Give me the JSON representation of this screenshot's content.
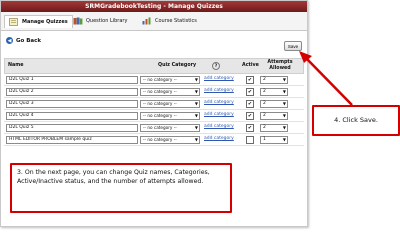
{
  "window": {
    "title": "SRMGradebookTesting - Manage Quizzes"
  },
  "tabs": [
    {
      "label": "Manage Quizzes",
      "icon": "manage-quizzes-icon"
    },
    {
      "label": "Question Library",
      "icon": "question-library-icon"
    },
    {
      "label": "Course Statistics",
      "icon": "course-statistics-icon"
    }
  ],
  "toolbar": {
    "go_back": "Go Back",
    "save": "Save"
  },
  "table": {
    "headers": {
      "name": "Name",
      "category": "Quiz Category",
      "active": "Active",
      "attempts": "Attempts Allowed"
    },
    "rows": [
      {
        "name": "D2L Quiz 1",
        "category": "-- no category --",
        "add_category": "add category",
        "active_mark": "✔",
        "attempts": "2"
      },
      {
        "name": "D2L Quiz 2",
        "category": "-- no category --",
        "add_category": "add category",
        "active_mark": "✔",
        "attempts": "2"
      },
      {
        "name": "D2L Quiz 3",
        "category": "-- no category --",
        "add_category": "add category",
        "active_mark": "✔",
        "attempts": "2"
      },
      {
        "name": "D2L Quiz 4",
        "category": "-- no category --",
        "add_category": "add category",
        "active_mark": "✔",
        "attempts": "2"
      },
      {
        "name": "D2L Quiz 5",
        "category": "-- no category --",
        "add_category": "add category",
        "active_mark": "✔",
        "attempts": "2"
      },
      {
        "name": "HTML EDITOR PROBLEM sample quiz",
        "category": "-- no category --",
        "add_category": "add category",
        "active_mark": "",
        "attempts": "1"
      }
    ]
  },
  "callouts": {
    "step4": "4.  Click Save.",
    "step3": "3.  On the next page, you can change Quiz names, Categories, Active/Inactive status, and the number of attempts allowed."
  },
  "colors": {
    "titlebar": "#8b2323",
    "callout_border": "#d40000",
    "link": "#2f57b1"
  }
}
